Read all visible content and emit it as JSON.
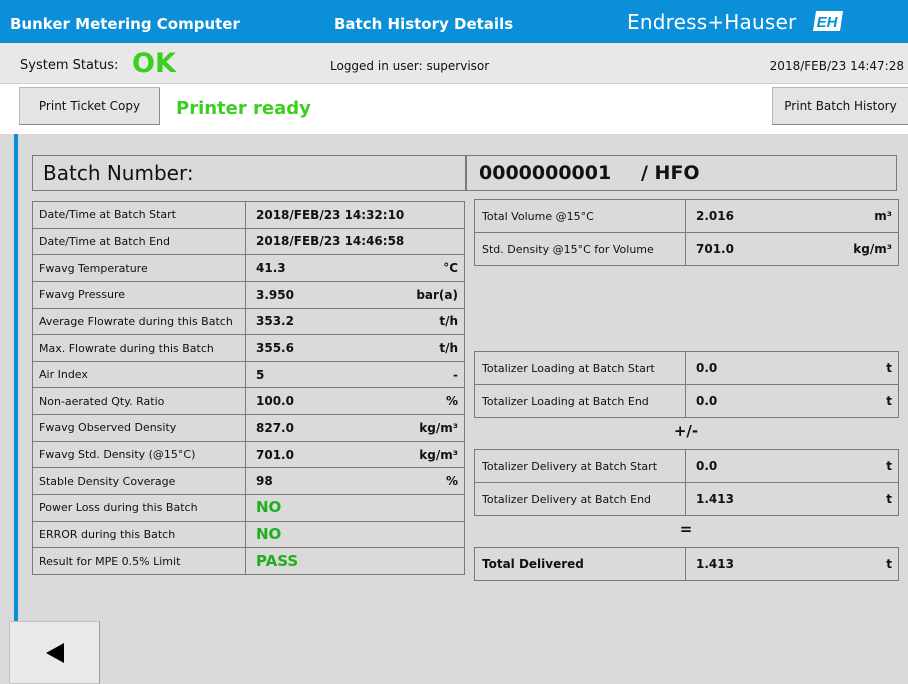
{
  "header": {
    "app_title": "Bunker Metering Computer",
    "page_title": "Batch History Details",
    "brand": "Endress+Hauser",
    "logo_text": "EH",
    "color": "#0a8fd8"
  },
  "status": {
    "system_label": "System Status:",
    "system_value": "OK",
    "user": "Logged in user: supervisor",
    "datetime": "2018/FEB/23  14:47:28"
  },
  "toolbar": {
    "print_ticket": "Print Ticket Copy",
    "printer_status": "Printer ready",
    "print_history": "Print Batch History"
  },
  "batch": {
    "label": "Batch Number:",
    "number": "0000000001",
    "product": "/ HFO"
  },
  "left_rows": [
    {
      "label": "Date/Time at Batch Start",
      "value": "2018/FEB/23 14:32:10",
      "unit": ""
    },
    {
      "label": "Date/Time at Batch End",
      "value": "2018/FEB/23 14:46:58",
      "unit": ""
    },
    {
      "label": "Fwavg Temperature",
      "value": "41.3",
      "unit": "°C"
    },
    {
      "label": "Fwavg Pressure",
      "value": "3.950",
      "unit": "bar(a)"
    },
    {
      "label": "Average Flowrate during this Batch",
      "value": "353.2",
      "unit": "t/h"
    },
    {
      "label": "Max. Flowrate during this Batch",
      "value": "355.6",
      "unit": "t/h"
    },
    {
      "label": "Air Index",
      "value": "5",
      "unit": "-"
    },
    {
      "label": "Non-aerated Qty. Ratio",
      "value": "100.0",
      "unit": "%"
    },
    {
      "label": "Fwavg Observed Density",
      "value": "827.0",
      "unit": "kg/m³"
    },
    {
      "label": "Fwavg Std. Density (@15°C)",
      "value": "701.0",
      "unit": "kg/m³"
    },
    {
      "label": "Stable Density Coverage",
      "value": "98",
      "unit": "%"
    },
    {
      "label": "Power Loss during this Batch",
      "value": "NO",
      "unit": ""
    },
    {
      "label": "ERROR during this Batch",
      "value": "NO",
      "unit": ""
    },
    {
      "label": "Result for MPE 0.5% Limit",
      "value": "PASS",
      "unit": ""
    }
  ],
  "right": {
    "volume_rows": [
      {
        "label": "Total Volume @15°C",
        "value": "2.016",
        "unit": "m³"
      },
      {
        "label": "Std. Density @15°C for Volume",
        "value": "701.0",
        "unit": "kg/m³"
      }
    ],
    "loading_rows": [
      {
        "label": "Totalizer Loading at Batch Start",
        "value": "0.0",
        "unit": "t"
      },
      {
        "label": "Totalizer Loading at Batch End",
        "value": "0.0",
        "unit": "t"
      }
    ],
    "plus_minus": "+/-",
    "delivery_rows": [
      {
        "label": "Totalizer Delivery at Batch Start",
        "value": "0.0",
        "unit": "t"
      },
      {
        "label": "Totalizer Delivery at Batch End",
        "value": "1.413",
        "unit": "t"
      }
    ],
    "equals": "=",
    "total": {
      "label": "Total Delivered",
      "value": "1.413",
      "unit": "t"
    }
  },
  "nav": {
    "back_icon": "back-arrow-icon"
  }
}
